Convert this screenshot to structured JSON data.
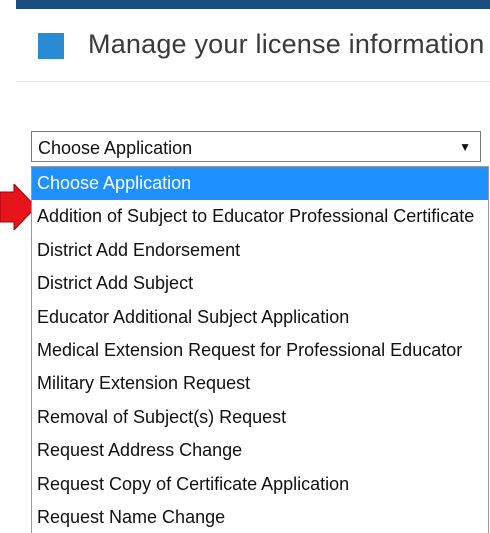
{
  "header": {
    "title": "Manage your license information",
    "accent_color": "#2a8ad3",
    "rule_color": "#1b4c7e",
    "icon": "square-icon"
  },
  "application_select": {
    "value": "Choose Application",
    "caret": "▼",
    "options": [
      "Choose Application",
      "Addition of Subject to Educator Professional Certificate",
      "District Add Endorsement",
      "District Add Subject",
      "Educator Additional Subject Application",
      "Medical Extension Request for Professional Educator",
      "Military Extension Request",
      "Removal of Subject(s) Request",
      "Request Address Change",
      "Request Copy of Certificate Application",
      "Request Name Change"
    ],
    "highlighted_index": 0,
    "highlight_color": "#1e90ff"
  },
  "pointer": {
    "icon": "red-arrow-icon",
    "color": "#e8141c",
    "target_index": 1
  }
}
